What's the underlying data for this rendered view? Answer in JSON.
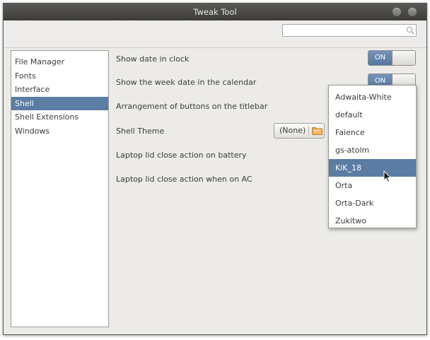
{
  "window": {
    "title": "Tweak Tool"
  },
  "search": {
    "value": "",
    "placeholder": "",
    "icon": "search-icon"
  },
  "sidebar": {
    "items": [
      {
        "label": "File Manager",
        "selected": false
      },
      {
        "label": "Fonts",
        "selected": false
      },
      {
        "label": "Interface",
        "selected": false
      },
      {
        "label": "Shell",
        "selected": true
      },
      {
        "label": "Shell Extensions",
        "selected": false
      },
      {
        "label": "Windows",
        "selected": false
      }
    ]
  },
  "settings": {
    "show_date": {
      "label": "Show date in clock",
      "switch_label": "ON"
    },
    "week_date": {
      "label": "Show the week date in the calendar",
      "switch_label": "ON"
    },
    "button_arrangement": {
      "label": "Arrangement of buttons on the titlebar"
    },
    "shell_theme": {
      "label": "Shell Theme",
      "chooser_value": "(None)",
      "chooser_icon": "folder-icon"
    },
    "lid_battery": {
      "label": "Laptop lid close action on battery"
    },
    "lid_ac": {
      "label": "Laptop lid close action when on AC"
    }
  },
  "theme_dropdown": {
    "options": [
      "Adwaita-White",
      "default",
      "Faience",
      "gs-atolm",
      "KiK_18",
      "Orta",
      "Orta-Dark",
      "Zukitwo"
    ],
    "selected": "KiK_18"
  },
  "colors": {
    "accent": "#5b7ca3",
    "titlebar": "#4a4945",
    "background": "#ecebe8"
  }
}
